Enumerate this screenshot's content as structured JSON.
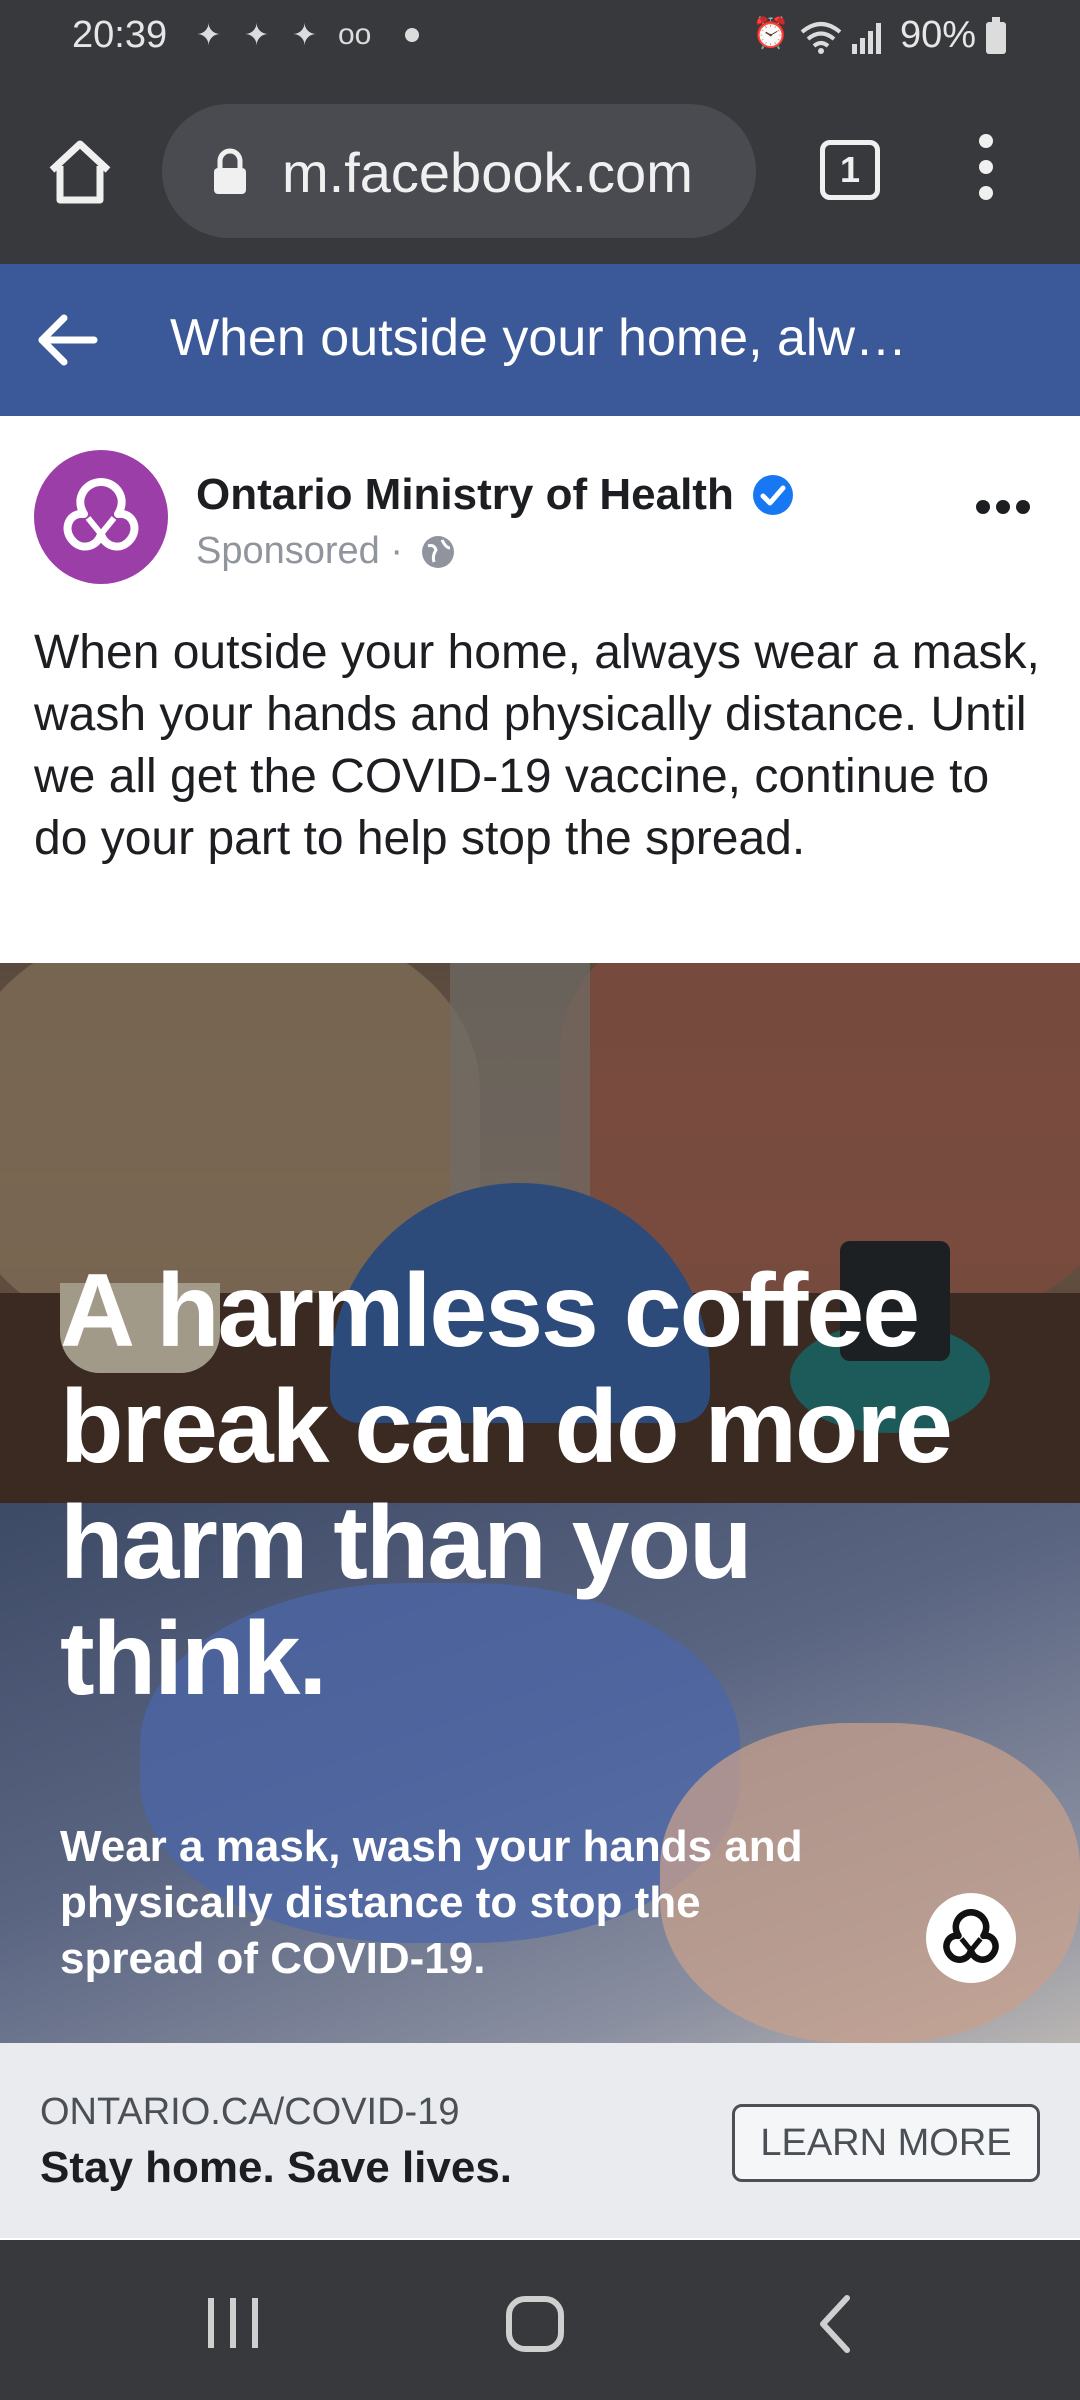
{
  "status_bar": {
    "time": "20:39",
    "battery": "90%",
    "notification_icons": [
      "messenger-icon",
      "messenger-icon",
      "messenger-icon",
      "voicemail-icon"
    ],
    "system_icons": [
      "alarm-icon",
      "wifi-icon",
      "signal-icon",
      "battery-icon"
    ]
  },
  "browser": {
    "url": "m.facebook.com",
    "tab_count": "1"
  },
  "fb_header": {
    "title": "When outside your home, alw…"
  },
  "post": {
    "page_name": "Ontario Ministry of Health",
    "sponsored_label": "Sponsored ·",
    "text": "When outside your home, always wear a mask, wash your hands and physically distance. Until we all get the COVID-19 vaccine, continue to do your part to help stop the spread.",
    "ad_headline": "A harmless coffee break can do more harm than you think.",
    "ad_subtext": "Wear a mask, wash your hands and physically distance to stop the spread of COVID-19."
  },
  "cta": {
    "url": "ONTARIO.CA/COVID-19",
    "title": "Stay home. Save lives.",
    "button_label": "LEARN MORE"
  },
  "colors": {
    "fb_blue": "#3b5998",
    "avatar_purple": "#9c3ea8",
    "verified_blue": "#1877f2",
    "system_bar": "#38393d"
  }
}
